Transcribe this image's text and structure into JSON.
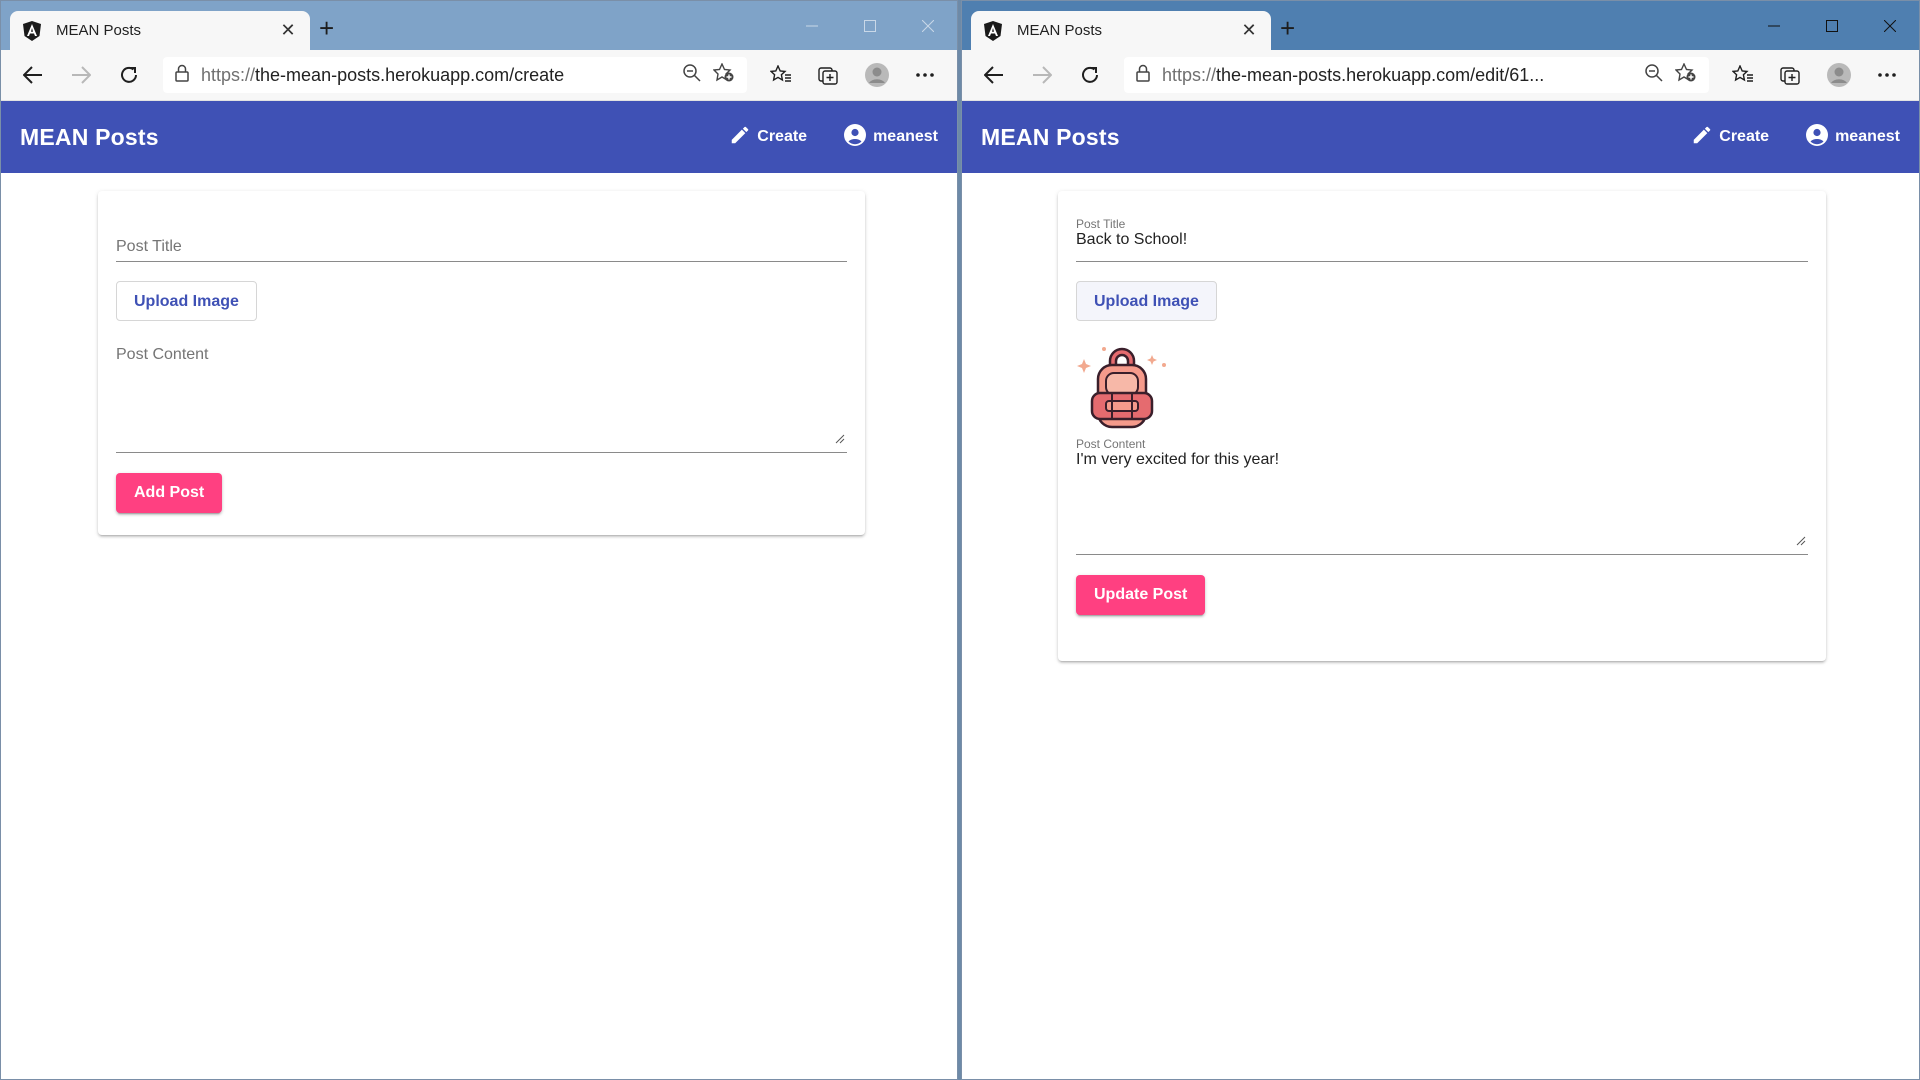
{
  "left_window": {
    "tab": {
      "title": "MEAN Posts"
    },
    "address": {
      "proto": "https://",
      "rest": "the-mean-posts.herokuapp.com/create"
    },
    "toolbar": {
      "title": "MEAN Posts",
      "create_label": "Create",
      "user_label": "meanest"
    },
    "form": {
      "title_placeholder": "Post Title",
      "upload_label": "Upload Image",
      "content_placeholder": "Post Content",
      "submit_label": "Add Post"
    }
  },
  "right_window": {
    "tab": {
      "title": "MEAN Posts"
    },
    "address": {
      "proto": "https://",
      "rest": "the-mean-posts.herokuapp.com/edit/61..."
    },
    "toolbar": {
      "title": "MEAN Posts",
      "create_label": "Create",
      "user_label": "meanest"
    },
    "form": {
      "title_label": "Post Title",
      "title_value": "Back to School!",
      "upload_label": "Upload Image",
      "image_icon": "backpack-icon",
      "content_label": "Post Content",
      "content_value": "I'm very excited for this year!",
      "submit_label": "Update Post"
    }
  },
  "colors": {
    "primary": "#3f51b5",
    "accent": "#ff4081",
    "titlebar_left": "#7fa3c8",
    "titlebar_right": "#4f7fb0"
  }
}
